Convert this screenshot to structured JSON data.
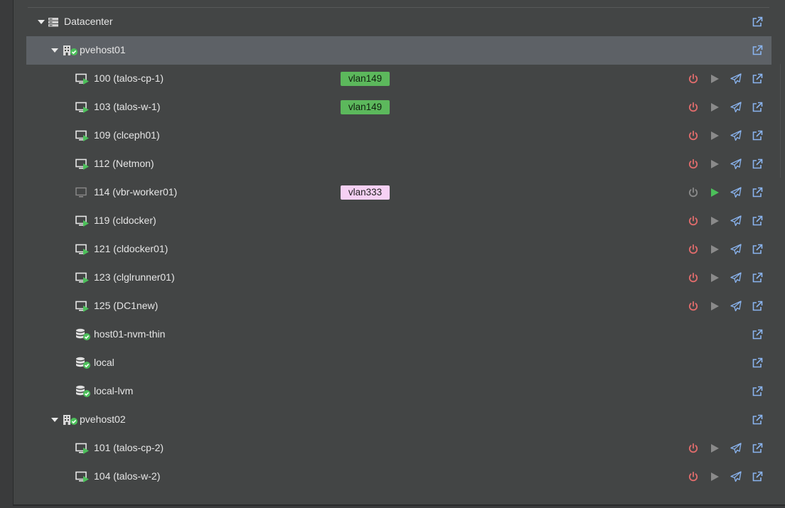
{
  "colors": {
    "background": "#434545",
    "selected_row": "#5d6166",
    "vlan_green": "#5cb85c",
    "vlan_pink": "#f6d1f4",
    "power_on": "#e06c6c",
    "power_off": "#8a8a8a",
    "start_active": "#4cc05a",
    "start_inactive": "#8a8a8a",
    "action_blue": "#8ab4ef",
    "status_ok": "#4cc05a"
  },
  "tree": {
    "datacenter": {
      "label": "Datacenter",
      "icon": "server-stack-icon"
    },
    "nodes": [
      {
        "label": "pvehost01",
        "icon": "building-icon",
        "guests": [
          {
            "label": "100 (talos-cp-1)",
            "tag": "vlan149",
            "tag_color": "green",
            "running": true
          },
          {
            "label": "103 (talos-w-1)",
            "tag": "vlan149",
            "tag_color": "green",
            "running": true
          },
          {
            "label": "109 (clceph01)",
            "running": true
          },
          {
            "label": "112 (Netmon)",
            "running": true
          },
          {
            "label": "114 (vbr-worker01)",
            "tag": "vlan333",
            "tag_color": "pink",
            "running": false
          },
          {
            "label": "119 (cldocker)",
            "running": true
          },
          {
            "label": "121 (cldocker01)",
            "running": true
          },
          {
            "label": "123 (clglrunner01)",
            "running": true
          },
          {
            "label": "125 (DC1new)",
            "running": true
          }
        ],
        "storages": [
          {
            "label": "host01-nvm-thin"
          },
          {
            "label": "local"
          },
          {
            "label": "local-lvm"
          }
        ]
      },
      {
        "label": "pvehost02",
        "icon": "building-icon",
        "guests": [
          {
            "label": "101 (talos-cp-2)",
            "running": true
          },
          {
            "label": "104 (talos-w-2)",
            "running": true
          }
        ]
      }
    ]
  }
}
